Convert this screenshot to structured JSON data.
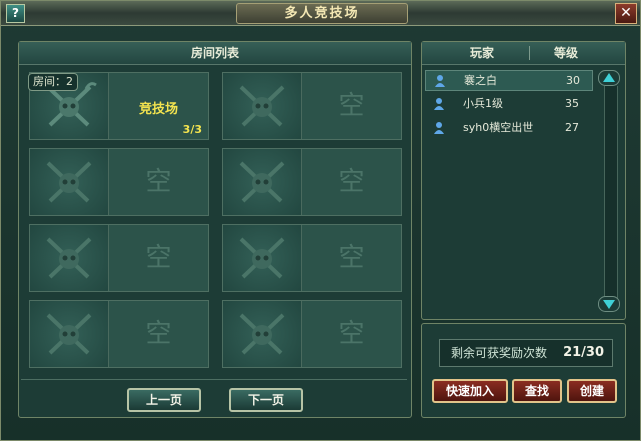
{
  "window": {
    "title": "多人竞技场",
    "help_label": "?",
    "close_label": "✕"
  },
  "rooms_panel": {
    "header": "房间列表",
    "rooms": [
      {
        "id_label": "房间：2",
        "name": "竞技场",
        "count": "3/3"
      },
      {
        "empty_label": "空"
      },
      {
        "empty_label": "空"
      },
      {
        "empty_label": "空"
      },
      {
        "empty_label": "空"
      },
      {
        "empty_label": "空"
      },
      {
        "empty_label": "空"
      },
      {
        "empty_label": "空"
      }
    ],
    "prev_page": "上一页",
    "next_page": "下一页"
  },
  "players_panel": {
    "col_player": "玩家",
    "col_level": "等级",
    "players": [
      {
        "name": "褰之白",
        "level": "30"
      },
      {
        "name": "小兵1级",
        "level": "35"
      },
      {
        "name": "syh0横空出世",
        "level": "27"
      }
    ],
    "icon_color": "#5fa7e8"
  },
  "reward": {
    "label": "剩余可获奖励次数",
    "value": "21/30"
  },
  "actions": {
    "quick_join": "快速加入",
    "search": "查找",
    "create": "创建"
  },
  "colors": {
    "accent_gold": "#f3e34f",
    "button_red": "#8a2d22",
    "panel_teal": "#1d3c36"
  }
}
